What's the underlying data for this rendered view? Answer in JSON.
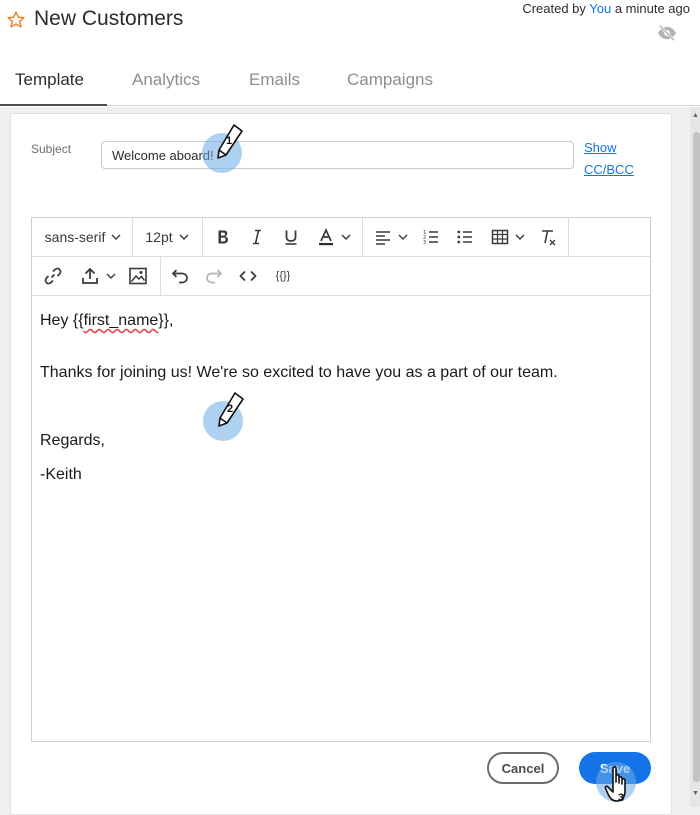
{
  "header": {
    "title": "New Customers",
    "created_prefix": "Created by ",
    "created_by": "You",
    "created_suffix": " a minute ago"
  },
  "tabs": [
    {
      "label": "Template",
      "active": true
    },
    {
      "label": "Analytics",
      "active": false
    },
    {
      "label": "Emails",
      "active": false
    },
    {
      "label": "Campaigns",
      "active": false
    }
  ],
  "subject": {
    "label": "Subject",
    "value": "Welcome aboard!"
  },
  "cc_link": {
    "line1": "Show",
    "line2": "CC/BCC"
  },
  "toolbar": {
    "font_family": "sans-serif",
    "font_size": "12pt",
    "token_button": "{{}}"
  },
  "editor": {
    "greeting_prefix": "Hey {{",
    "greeting_token": "first_name",
    "greeting_suffix": "}},",
    "line_body": "Thanks for joining us! We're so excited to have you as a part of our team.",
    "line_regards": "Regards,",
    "line_signature": "-Keith"
  },
  "actions": {
    "cancel": "Cancel",
    "save": "Save"
  },
  "annotations": {
    "step1": "1",
    "step2": "2",
    "step3": "3"
  },
  "colors": {
    "accent": "#1473e6",
    "marker": "#6caae6"
  }
}
